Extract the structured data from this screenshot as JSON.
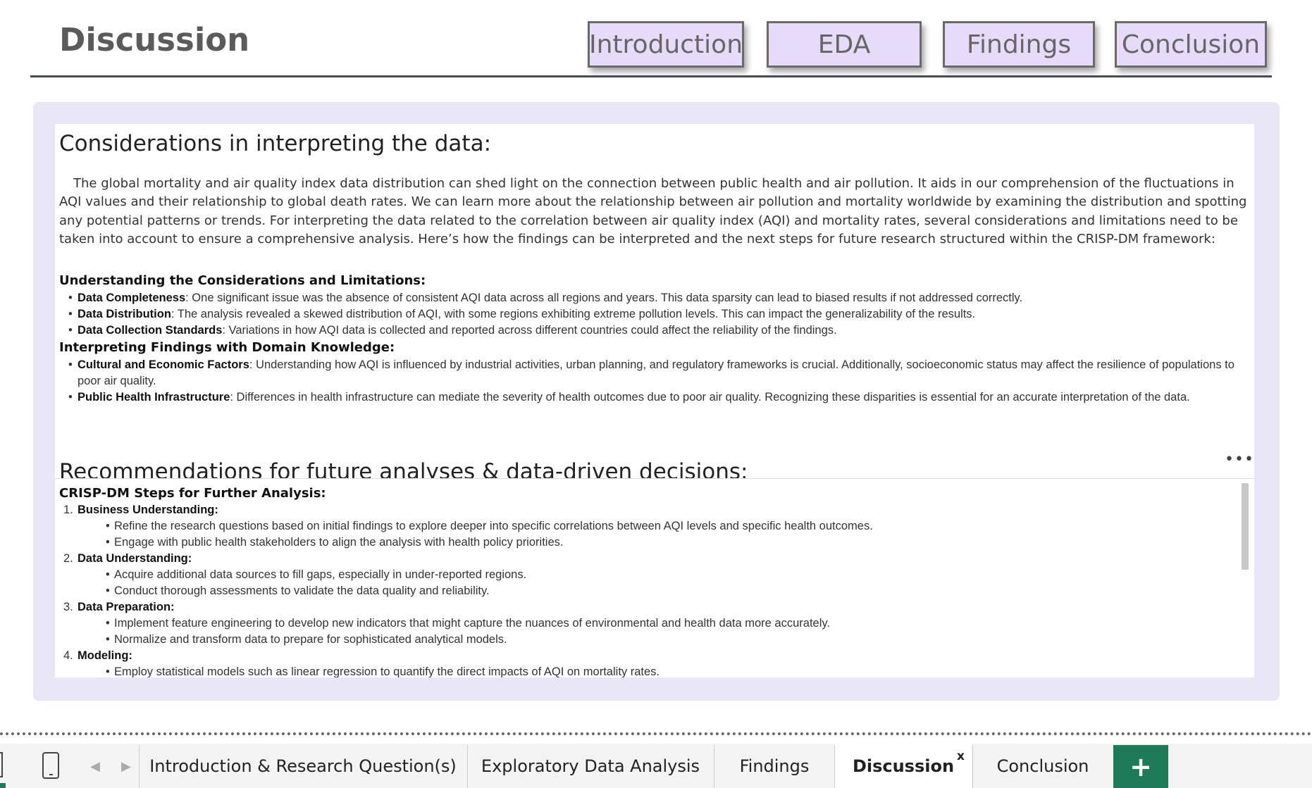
{
  "header": {
    "title": "Discussion",
    "nav": [
      "Introduction",
      "EDA",
      "Findings",
      "Conclusion"
    ]
  },
  "section1": {
    "title": "Considerations in interpreting the data:",
    "paragraph": "The global mortality and air quality index data distribution can shed light on the connection between public health and air pollution. It aids in our comprehension of the fluctuations in AQI values and their relationship to global death rates. We can learn more about the relationship between air pollution and mortality worldwide by examining the distribution and spotting any potential patterns or trends. For interpreting the data related to the correlation between air quality index (AQI) and mortality rates, several considerations and limitations need to be taken into account to ensure a comprehensive analysis. Here’s how the findings can be interpreted and the next steps for future research structured within the CRISP-DM framework:",
    "heading1": "Understanding the Considerations and Limitations:",
    "items1": [
      {
        "term": "Data Completeness",
        "text": ": One significant issue was the absence of consistent AQI data across all regions and years. This data sparsity can lead to biased results if not addressed correctly."
      },
      {
        "term": "Data Distribution",
        "text": ": The analysis revealed a skewed distribution of AQI, with some regions exhibiting extreme pollution levels. This can impact the generalizability of the results."
      },
      {
        "term": "Data Collection Standards",
        "text": ": Variations in how AQI data is collected and reported across different countries could affect the reliability of the findings."
      }
    ],
    "heading2": "Interpreting Findings with Domain Knowledge:",
    "items2": [
      {
        "term": "Cultural and Economic Factors",
        "text": ": Understanding how AQI is influenced by industrial activities, urban planning, and regulatory frameworks is crucial. Additionally, socioeconomic status may affect the resilience of populations to poor air quality."
      },
      {
        "term": "Public Health Infrastructure",
        "text": ": Differences in health infrastructure can mediate the severity of health outcomes due to poor air quality. Recognizing these disparities is essential for an accurate interpretation of the data."
      }
    ]
  },
  "section2": {
    "title": "Recommendations for future analyses & data-driven decisions:",
    "heading": "CRISP-DM Steps for Further Analysis:",
    "steps": [
      {
        "num": "1.",
        "label": "Business Understanding:",
        "items": [
          "Refine the research questions based on initial findings to explore deeper into specific correlations between AQI levels and specific health outcomes.",
          "Engage with public health stakeholders to align the analysis with health policy priorities."
        ]
      },
      {
        "num": "2.",
        "label": "Data Understanding:",
        "items": [
          "Acquire additional data sources to fill gaps, especially in under-reported regions.",
          "Conduct thorough assessments to validate the data quality and reliability."
        ]
      },
      {
        "num": "3.",
        "label": "Data Preparation:",
        "items": [
          "Implement feature engineering to develop new indicators that might capture the nuances of environmental and health data more accurately.",
          "Normalize and transform data to prepare for sophisticated analytical models."
        ]
      },
      {
        "num": "4.",
        "label": "Modeling:",
        "items": [
          "Employ statistical models such as linear regression to quantify the direct impacts of AQI on mortality rates."
        ]
      }
    ]
  },
  "more_options": "•••",
  "tabs": [
    "Introduction & Research Question(s)",
    "Exploratory Data Analysis",
    "Findings",
    "Discussion",
    "Conclusion"
  ],
  "active_tab": "Discussion",
  "tab_close": "x",
  "add_tab": "+",
  "icons": {
    "phone": "phone-layout-icon",
    "prev": "chevron-left-icon",
    "next": "chevron-right-icon"
  },
  "colors": {
    "nav_fill": "#e6dcf9",
    "panel_bg": "#e9e6f7",
    "add_tab_green": "#1e7b58"
  }
}
